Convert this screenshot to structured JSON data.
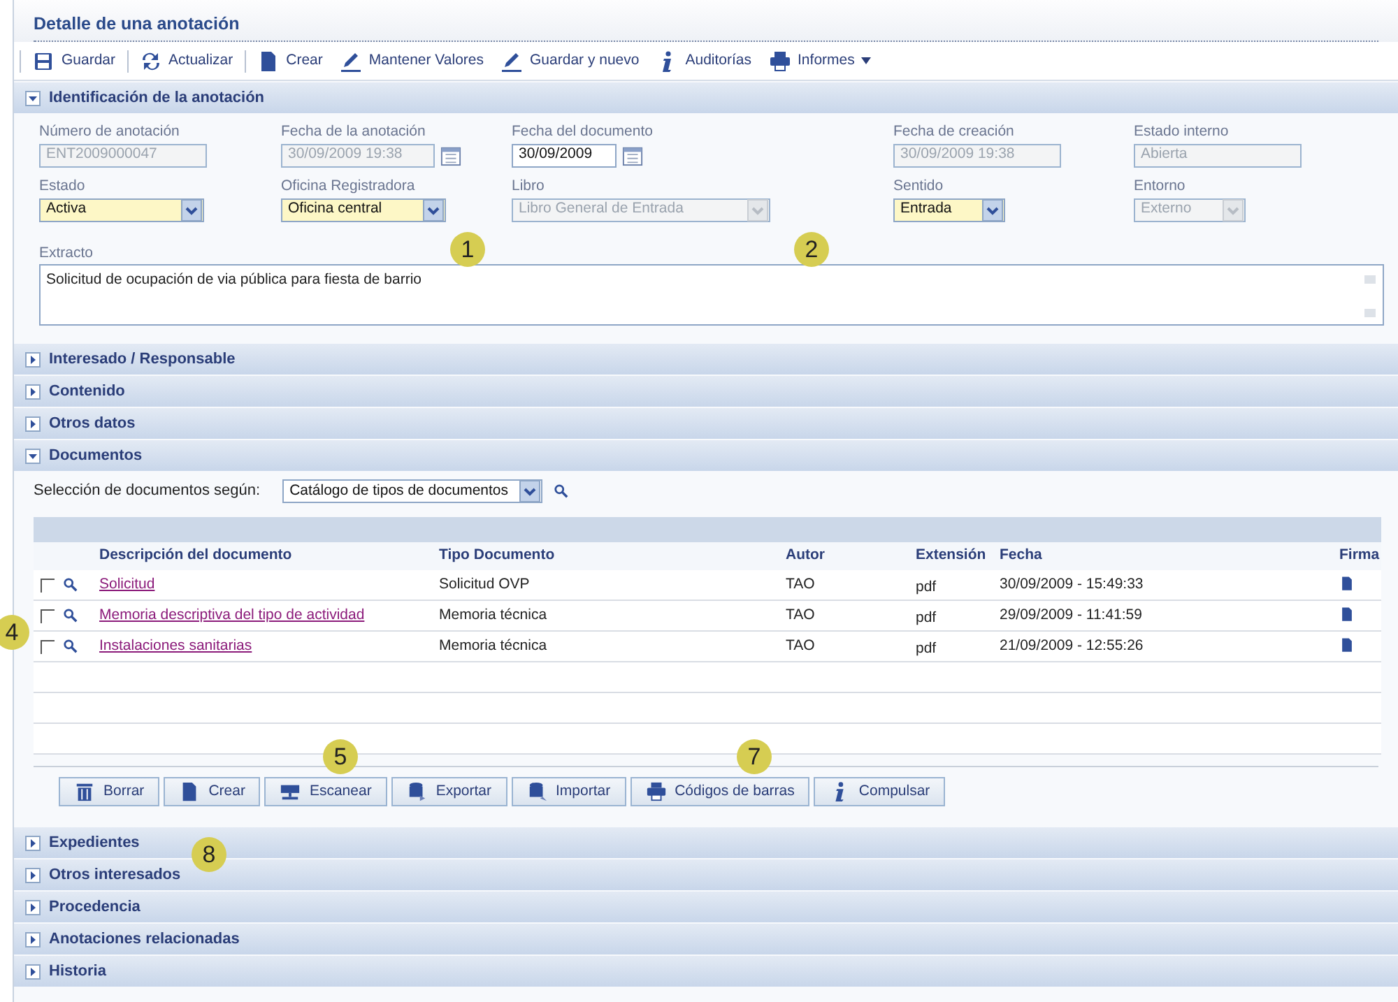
{
  "window": {
    "title": "Detalle de una anotación"
  },
  "toolbar": [
    "Guardar",
    "Actualizar",
    "Crear",
    "Mantener Valores",
    "Guardar y nuevo",
    "Auditorías",
    "Informes"
  ],
  "sections": [
    {
      "title": "Identificación de la anotación",
      "expanded": true,
      "kind": "form",
      "rows": [
        [
          {
            "label": "Número de anotación",
            "value": "ENT2009000047",
            "kind": "text",
            "disabled": true,
            "required": false
          },
          {
            "label": "Fecha de la anotación",
            "value": "30/09/2009 19:38",
            "kind": "date",
            "disabled": true,
            "required": false
          },
          {
            "label": "Fecha del documento",
            "value": "30/09/2009",
            "kind": "date",
            "disabled": false,
            "required": false
          },
          {
            "label": "Fecha de creación",
            "value": "30/09/2009 19:38",
            "kind": "text",
            "disabled": true,
            "required": false
          },
          {
            "label": "Estado interno",
            "value": "Abierta",
            "kind": "text",
            "disabled": true,
            "required": false
          }
        ],
        [
          {
            "label": "Estado",
            "value": "Activa",
            "kind": "select",
            "disabled": false,
            "required": true
          },
          {
            "label": "Oficina Registradora",
            "value": "Oficina central",
            "kind": "select",
            "disabled": false,
            "required": true
          },
          {
            "label": "Libro",
            "value": "Libro General de Entrada",
            "kind": "select",
            "disabled": true,
            "required": false
          },
          {
            "label": "Sentido",
            "value": "Entrada",
            "kind": "select",
            "disabled": false,
            "required": true
          },
          {
            "label": "Entorno",
            "value": "Externo",
            "kind": "select",
            "disabled": true,
            "required": false
          }
        ]
      ],
      "extract": {
        "label": "Extracto",
        "value": "Solicitud de ocupación de via pública para fiesta de barrio"
      }
    },
    {
      "title": "Interesado / Responsable",
      "expanded": false
    },
    {
      "title": "Contenido",
      "expanded": false
    },
    {
      "title": "Otros datos",
      "expanded": false
    },
    {
      "title": "Documentos",
      "expanded": true,
      "kind": "documents",
      "filter": {
        "label": "Selección de documentos según:",
        "value": "Catálogo de tipos de documentos"
      },
      "table": {
        "columns": [
          "Descripción del documento",
          "Tipo Documento",
          "Autor",
          "Extensión",
          "Fecha",
          "Firma"
        ],
        "rows": [
          {
            "checked": false,
            "description": "Solicitud",
            "type": "Solicitud OVP",
            "author": "TAO",
            "extension": "pdf",
            "date": "30/09/2009 - 15:49:33"
          },
          {
            "checked": false,
            "description": "Memoria descriptiva del tipo de actividad",
            "type": "Memoria técnica",
            "author": "TAO",
            "extension": "pdf",
            "date": "29/09/2009 - 11:41:59"
          },
          {
            "checked": false,
            "description": "Instalaciones sanitarias",
            "type": "Memoria técnica",
            "author": "TAO",
            "extension": "pdf",
            "date": "21/09/2009 - 12:55:26"
          }
        ]
      },
      "buttons": [
        "Borrar",
        "Crear",
        "Escanear",
        "Exportar",
        "Importar",
        "Códigos de barras",
        "Compulsar"
      ]
    },
    {
      "title": "Expedientes",
      "expanded": false
    },
    {
      "title": "Otros interesados",
      "expanded": false
    },
    {
      "title": "Procedencia",
      "expanded": false
    },
    {
      "title": "Anotaciones relacionadas",
      "expanded": false
    },
    {
      "title": "Historia",
      "expanded": false
    }
  ],
  "callouts": [
    "1",
    "2",
    "4",
    "5",
    "7",
    "8"
  ]
}
